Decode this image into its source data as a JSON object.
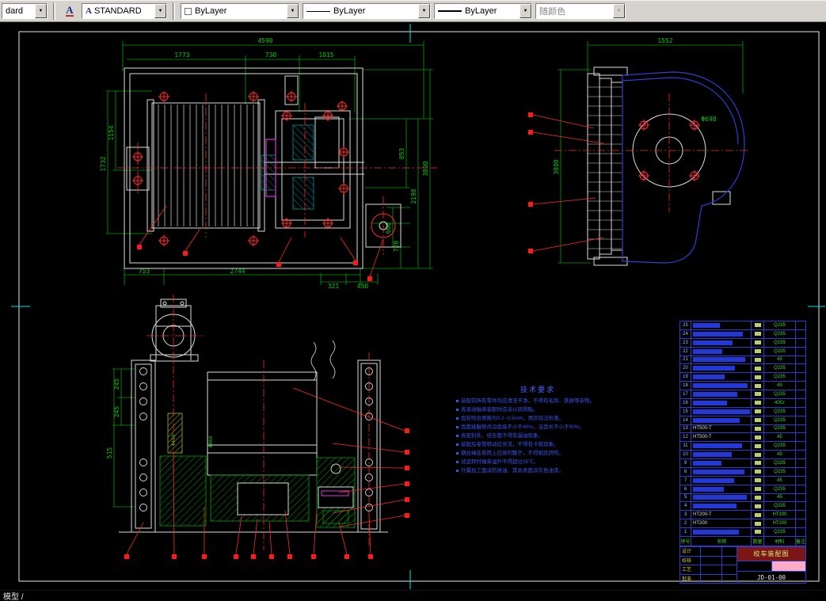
{
  "toolbar": {
    "style_combo": "dard",
    "textstyle_combo": "STANDARD",
    "color_combo": "ByLayer",
    "linetype_combo": "ByLayer",
    "lineweight_combo": "ByLayer",
    "plotstyle_combo": "随颜色"
  },
  "dims": {
    "d4590": "4590",
    "d1773": "1773",
    "d730": "730",
    "d1015": "1015",
    "d1154": "1154",
    "d1732": "1732",
    "d3800a": "3800",
    "d2198": "2198",
    "d853": "853",
    "d720": "720",
    "d600": "600",
    "d753": "753",
    "d2744": "2744",
    "d321": "321",
    "d450": "450",
    "d1552": "1552",
    "d3800b": "3800",
    "d698": "Φ698",
    "d245a": "245",
    "d245b": "245",
    "d515": "515",
    "d410": "Φ410",
    "d460": "Φ460"
  },
  "notes": {
    "title": "技术要求",
    "lines": [
      "装配前所有零件均应清洗干净，不得有毛刺、铁屑等杂物。",
      "各滚动轴承装配时应涂以润滑脂。",
      "齿轮啮合侧隙为0.2~0.5mm，用压铅法检查。",
      "齿面接触斑点沿齿高不小于40%，沿齿长不小于50%。",
      "各密封处、结合面不得有漏油现象。",
      "装配后卷筒转动应灵活，不得有卡阻现象。",
      "钢丝绳在卷筒上应排列整齐，不得相互挤咬。",
      "试运转时轴承温升不得超过35℃。",
      "外露加工面涂防锈油，其余表面涂灰色油漆。"
    ]
  },
  "bom": {
    "headers": [
      "序号",
      "名称",
      "数量",
      "材料",
      "备注"
    ],
    "rows": [
      {
        "n": "25",
        "m": "Q235"
      },
      {
        "n": "24",
        "m": "Q235"
      },
      {
        "n": "23",
        "m": "Q235"
      },
      {
        "n": "22",
        "m": "Q235"
      },
      {
        "n": "21",
        "m": "45"
      },
      {
        "n": "20",
        "m": "Q235"
      },
      {
        "n": "19",
        "m": "Q235"
      },
      {
        "n": "18",
        "m": "45"
      },
      {
        "n": "17",
        "m": "Q235"
      },
      {
        "n": "16",
        "m": "40Cr"
      },
      {
        "n": "15",
        "m": "Q235"
      },
      {
        "n": "14",
        "m": "Q235"
      },
      {
        "n": "13",
        "t": "HT500-T",
        "m": "Q235"
      },
      {
        "n": "12",
        "t": "HT500-T",
        "m": "45"
      },
      {
        "n": "11",
        "m": "Q235"
      },
      {
        "n": "10",
        "m": "45"
      },
      {
        "n": "9",
        "m": "Q235"
      },
      {
        "n": "8",
        "m": "Q235"
      },
      {
        "n": "7",
        "m": "45"
      },
      {
        "n": "6",
        "m": "Q235"
      },
      {
        "n": "5",
        "m": "45"
      },
      {
        "n": "4",
        "m": "Q235"
      },
      {
        "n": "3",
        "t": "HT200-T",
        "m": "HT200"
      },
      {
        "n": "2",
        "t": "HT200",
        "m": "HT200"
      },
      {
        "n": "1",
        "m": "Q235"
      }
    ]
  },
  "title_block": {
    "left_labels": [
      "设计",
      "校核",
      "工艺",
      "批准"
    ],
    "title": "绞车装配图",
    "code": "JD-01-00"
  },
  "status": {
    "tab": "模型 /"
  }
}
